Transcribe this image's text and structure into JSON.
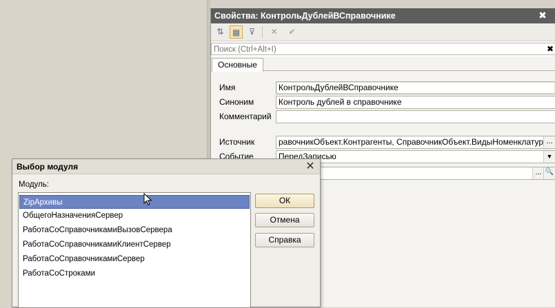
{
  "properties_panel": {
    "title": "Свойства: КонтрольДублейВСправочнике",
    "close_glyph": "✖",
    "toolbar": {
      "sort_glyph": "⇅",
      "categories_glyph": "▦",
      "filter_glyph": "⊽",
      "clear_glyph": "✕",
      "check_glyph": "✔"
    },
    "search": {
      "placeholder": "Поиск (Ctrl+Alt+I)",
      "value": "",
      "clear_glyph": "✖"
    },
    "tabs": [
      {
        "label": "Основные"
      }
    ],
    "fields": {
      "name": {
        "label": "Имя",
        "value": "КонтрольДублейВСправочнике"
      },
      "synonym": {
        "label": "Синоним",
        "value": "Контроль дублей в справочнике"
      },
      "comment": {
        "label": "Комментарий",
        "value": ""
      },
      "source": {
        "label": "Источник",
        "value": "равочникОбъект.Контрагенты, СправочникОбъект.ВидыНоменклатуры",
        "button": "..."
      },
      "event": {
        "label": "Событие",
        "value": "ПередЗаписью",
        "button": "▼"
      },
      "handler": {
        "value": "",
        "button": "...",
        "search_glyph": "🔍"
      }
    }
  },
  "dialog": {
    "title": "Выбор модуля",
    "close_glyph": "✕",
    "module_label": "Модуль:",
    "modules": [
      "ZipАрхивы",
      "ОбщегоНазначенияСервер",
      "РаботаСоСправочникамиВызовСервера",
      "РаботаСоСправочникамиКлиентСервер",
      "РаботаСоСправочникамиСервер",
      "РаботаСоСтроками"
    ],
    "selected_index": 0,
    "buttons": {
      "ok": "ОК",
      "cancel": "Отмена",
      "help": "Справка"
    }
  },
  "colors": {
    "title_bar": "#5d5d5d",
    "selection": "#6c84c4",
    "ok_button": "#eee3bd"
  }
}
